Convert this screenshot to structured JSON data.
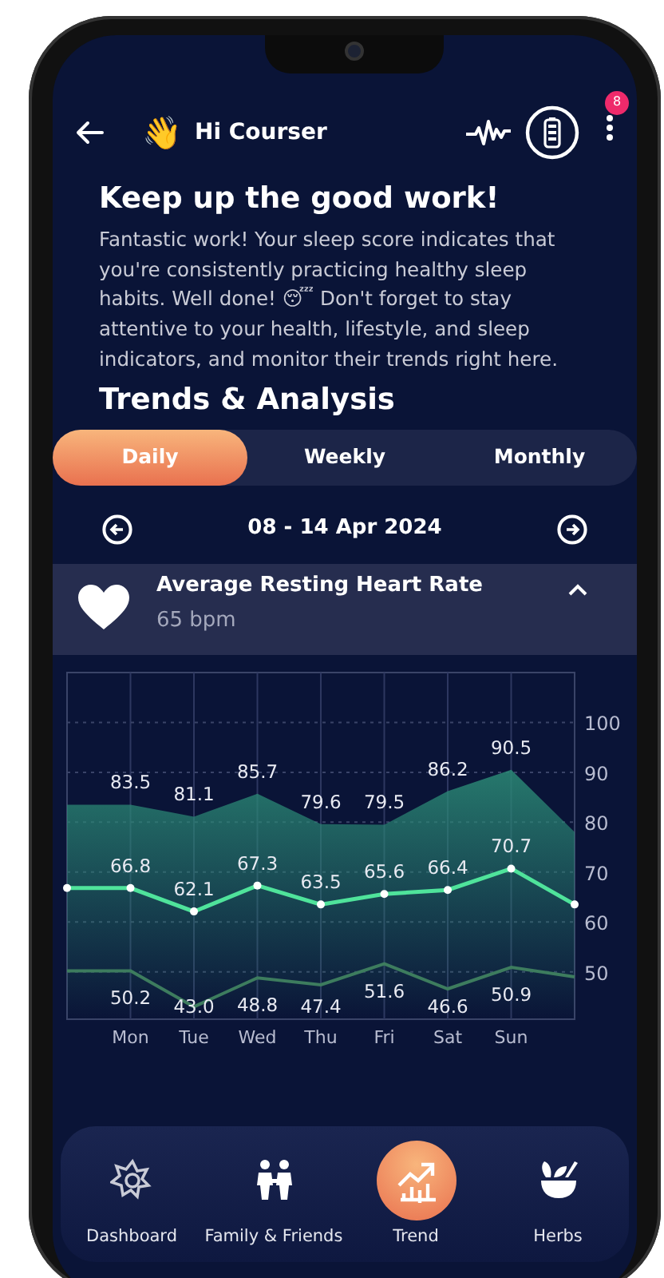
{
  "header": {
    "greeting_emoji": "👋",
    "greeting": "Hi Courser",
    "notification_count": "8"
  },
  "intro": {
    "title": "Keep up the good work!",
    "text": "Fantastic work! Your sleep score indicates that you're consistently practicing healthy sleep habits. Well done! 😴 Don't forget to stay attentive to your health, lifestyle, and sleep indicators, and monitor their trends right here."
  },
  "section_title": "Trends & Analysis",
  "period_tabs": [
    {
      "label": "Daily",
      "selected": true
    },
    {
      "label": "Weekly",
      "selected": false
    },
    {
      "label": "Monthly",
      "selected": false
    }
  ],
  "date_range": {
    "label": "08 - 14 Apr 2024"
  },
  "metric": {
    "title": "Average Resting Heart Rate",
    "value": "65 bpm",
    "expanded": true,
    "chart_data": {
      "type": "line",
      "categories": [
        null,
        "Mon",
        "Tue",
        "Wed",
        "Thu",
        "Fri",
        "Sat",
        "Sun",
        null
      ],
      "ylim": [
        40.5,
        110
      ],
      "yticks": [
        50,
        60,
        70,
        80,
        90,
        100
      ],
      "grid": true,
      "series": [
        {
          "type": "area",
          "color": "#2b8a76",
          "values": [
            83.5,
            83.5,
            81.1,
            85.7,
            79.6,
            79.5,
            86.2,
            90.5,
            78.0
          ],
          "value_labels": [
            null,
            "83.5",
            "81.1",
            "85.7",
            "79.6",
            "79.5",
            "86.2",
            "90.5",
            null
          ]
        },
        {
          "color": "#4fe39b",
          "marker": "circle",
          "values": [
            66.8,
            66.8,
            62.1,
            67.3,
            63.5,
            65.6,
            66.4,
            70.7,
            63.5
          ],
          "value_labels": [
            null,
            "66.8",
            "62.1",
            "67.3",
            "63.5",
            "65.6",
            "66.4",
            "70.7",
            null
          ]
        },
        {
          "color": "#3d7c5e",
          "values": [
            50.2,
            50.2,
            43.0,
            48.8,
            47.4,
            51.6,
            46.6,
            50.9,
            49.0
          ],
          "value_labels": [
            null,
            "50.2",
            "43.0",
            "48.8",
            "47.4",
            "51.6",
            "46.6",
            "50.9",
            null
          ]
        }
      ]
    }
  },
  "bottom_nav": [
    {
      "label": "Dashboard",
      "selected": false
    },
    {
      "label": "Family & Friends",
      "selected": false
    },
    {
      "label": "Trend",
      "selected": true
    },
    {
      "label": "Herbs",
      "selected": false
    }
  ]
}
